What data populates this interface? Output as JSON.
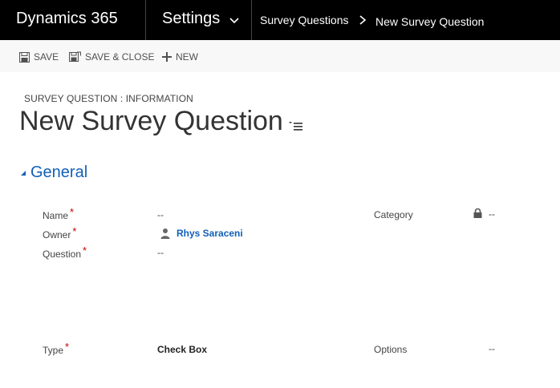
{
  "nav": {
    "brand": "Dynamics 365",
    "area": "Settings",
    "breadcrumb_entity": "Survey Questions",
    "breadcrumb_record": "New Survey Question"
  },
  "commands": {
    "save": "SAVE",
    "save_close": "SAVE & CLOSE",
    "new": "NEW"
  },
  "header": {
    "entity_form": "SURVEY QUESTION : INFORMATION",
    "title": "New Survey Question"
  },
  "section": {
    "title": "General"
  },
  "fields": {
    "name": {
      "label": "Name",
      "value": "--",
      "required": "*"
    },
    "owner": {
      "label": "Owner",
      "value": "Rhys Saraceni",
      "required": "*"
    },
    "question": {
      "label": "Question",
      "value": "--",
      "required": "*"
    },
    "type": {
      "label": "Type",
      "value": "Check Box",
      "required": "*"
    },
    "category": {
      "label": "Category",
      "value": "--"
    },
    "options": {
      "label": "Options",
      "value": "--"
    }
  },
  "icons": {
    "chevron": "chevron-down-icon",
    "breadcrumb_sep": "chevron-right-icon",
    "save": "save-icon",
    "save_close": "save-close-icon",
    "new": "plus-icon",
    "menu": "list-menu-icon",
    "collapse": "triangle-collapse-icon",
    "user": "user-icon",
    "lock": "lock-icon"
  },
  "colors": {
    "nav_bg": "#000000",
    "link": "#1160b7",
    "required": "#c00000"
  }
}
